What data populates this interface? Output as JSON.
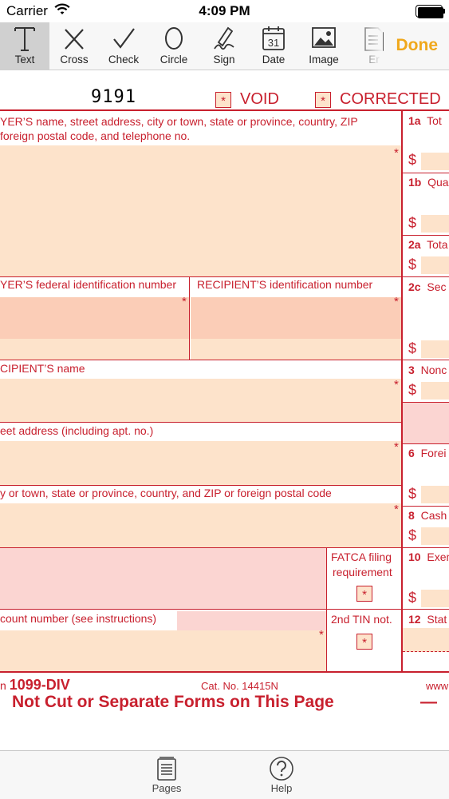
{
  "status_bar": {
    "carrier": "Carrier",
    "time": "4:09 PM",
    "icons": [
      "wifi-icon",
      "battery-icon"
    ]
  },
  "toolbar": {
    "tools": [
      {
        "label": "Text",
        "icon": "text-icon",
        "active": true
      },
      {
        "label": "Cross",
        "icon": "cross-icon"
      },
      {
        "label": "Check",
        "icon": "check-icon"
      },
      {
        "label": "Circle",
        "icon": "circle-icon"
      },
      {
        "label": "Sign",
        "icon": "signature-icon"
      },
      {
        "label": "Date",
        "icon": "calendar-icon",
        "icon_text": "31"
      },
      {
        "label": "Image",
        "icon": "image-icon"
      },
      {
        "label": "Er",
        "icon": "eraser-icon"
      }
    ],
    "done_label": "Done",
    "done_color": "#f0a81c"
  },
  "form": {
    "form_number_code": "9191",
    "void_label": "VOID",
    "corrected_label": "CORRECTED",
    "checkbox_mark": "*",
    "currency": "$",
    "payer_name_label_line1": "YER’S name, street address, city or town, state or province, country, ZIP",
    "payer_name_label_line2": "foreign postal code, and telephone no.",
    "payer_tin_label": "YER’S federal identification number",
    "recipient_tin_label": "RECIPIENT’S identification number",
    "recipient_name_label": "CIPIENT’S name",
    "street_label": "eet address (including apt. no.)",
    "city_label": "y or town, state or province, country, and ZIP or foreign postal code",
    "fatca_label_line1": "FATCA filing",
    "fatca_label_line2": "requirement",
    "account_label": "count number (see instructions)",
    "second_tin_label": "2nd TIN not.",
    "boxes": {
      "b1a_num": "1a",
      "b1a_text": "Tot",
      "b1b_num": "1b",
      "b1b_text": "Qua",
      "b2a_num": "2a",
      "b2a_text": "Tota",
      "b2c_num": "2c",
      "b2c_text": "Sec",
      "b3_num": "3",
      "b3_text": "Nonc",
      "b6_num": "6",
      "b6_text": "Forei",
      "b8_num": "8",
      "b8_text": "Cash",
      "b10_num": "10",
      "b10_text": "Exem",
      "b12_num": "12",
      "b12_text": "Stat"
    },
    "form_name_prefix": "n",
    "form_name": "1099-DIV",
    "cat_no": "Cat. No. 14415N",
    "www_text": "www",
    "do_not_cut": "Not  Cut  or  Separate  Forms  on  This  Page",
    "dash": "—",
    "red_color": "#c8202e",
    "fill_color": "#fde3cb"
  },
  "tabbar": {
    "pages_label": "Pages",
    "help_label": "Help",
    "pages_icon": "pages-icon",
    "help_icon": "help-icon"
  }
}
